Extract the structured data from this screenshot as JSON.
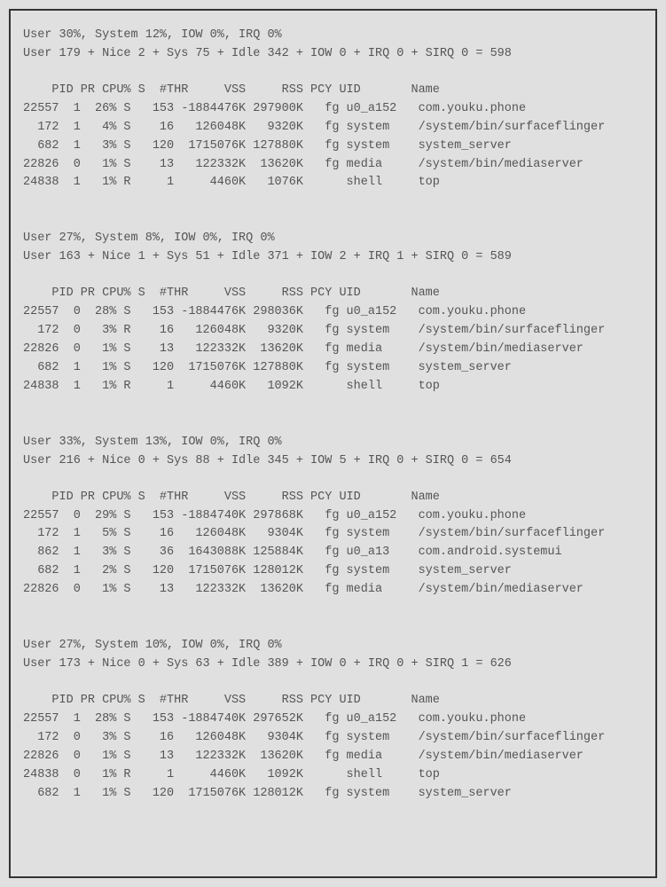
{
  "columns": [
    "PID",
    "PR",
    "CPU%",
    "S",
    "#THR",
    "VSS",
    "RSS",
    "PCY",
    "UID",
    "Name"
  ],
  "blocks": [
    {
      "summary1": "User 30%, System 12%, IOW 0%, IRQ 0%",
      "summary2": "User 179 + Nice 2 + Sys 75 + Idle 342 + IOW 0 + IRQ 0 + SIRQ 0 = 598",
      "rows": [
        {
          "pid": "22557",
          "pr": "1",
          "cpu": "26%",
          "s": "S",
          "thr": "153",
          "vss": "-1884476K",
          "rss": "297900K",
          "pcy": "fg",
          "uid": "u0_a152",
          "name": "com.youku.phone"
        },
        {
          "pid": "172",
          "pr": "1",
          "cpu": "4%",
          "s": "S",
          "thr": "16",
          "vss": "126048K",
          "rss": "9320K",
          "pcy": "fg",
          "uid": "system",
          "name": "/system/bin/surfaceflinger"
        },
        {
          "pid": "682",
          "pr": "1",
          "cpu": "3%",
          "s": "S",
          "thr": "120",
          "vss": "1715076K",
          "rss": "127880K",
          "pcy": "fg",
          "uid": "system",
          "name": "system_server"
        },
        {
          "pid": "22826",
          "pr": "0",
          "cpu": "1%",
          "s": "S",
          "thr": "13",
          "vss": "122332K",
          "rss": "13620K",
          "pcy": "fg",
          "uid": "media",
          "name": "/system/bin/mediaserver"
        },
        {
          "pid": "24838",
          "pr": "1",
          "cpu": "1%",
          "s": "R",
          "thr": "1",
          "vss": "4460K",
          "rss": "1076K",
          "pcy": "",
          "uid": "shell",
          "name": "top"
        }
      ]
    },
    {
      "summary1": "User 27%, System 8%, IOW 0%, IRQ 0%",
      "summary2": "User 163 + Nice 1 + Sys 51 + Idle 371 + IOW 2 + IRQ 1 + SIRQ 0 = 589",
      "rows": [
        {
          "pid": "22557",
          "pr": "0",
          "cpu": "28%",
          "s": "S",
          "thr": "153",
          "vss": "-1884476K",
          "rss": "298036K",
          "pcy": "fg",
          "uid": "u0_a152",
          "name": "com.youku.phone"
        },
        {
          "pid": "172",
          "pr": "0",
          "cpu": "3%",
          "s": "R",
          "thr": "16",
          "vss": "126048K",
          "rss": "9320K",
          "pcy": "fg",
          "uid": "system",
          "name": "/system/bin/surfaceflinger"
        },
        {
          "pid": "22826",
          "pr": "0",
          "cpu": "1%",
          "s": "S",
          "thr": "13",
          "vss": "122332K",
          "rss": "13620K",
          "pcy": "fg",
          "uid": "media",
          "name": "/system/bin/mediaserver"
        },
        {
          "pid": "682",
          "pr": "1",
          "cpu": "1%",
          "s": "S",
          "thr": "120",
          "vss": "1715076K",
          "rss": "127880K",
          "pcy": "fg",
          "uid": "system",
          "name": "system_server"
        },
        {
          "pid": "24838",
          "pr": "1",
          "cpu": "1%",
          "s": "R",
          "thr": "1",
          "vss": "4460K",
          "rss": "1092K",
          "pcy": "",
          "uid": "shell",
          "name": "top"
        }
      ]
    },
    {
      "summary1": "User 33%, System 13%, IOW 0%, IRQ 0%",
      "summary2": "User 216 + Nice 0 + Sys 88 + Idle 345 + IOW 5 + IRQ 0 + SIRQ 0 = 654",
      "rows": [
        {
          "pid": "22557",
          "pr": "0",
          "cpu": "29%",
          "s": "S",
          "thr": "153",
          "vss": "-1884740K",
          "rss": "297868K",
          "pcy": "fg",
          "uid": "u0_a152",
          "name": "com.youku.phone"
        },
        {
          "pid": "172",
          "pr": "1",
          "cpu": "5%",
          "s": "S",
          "thr": "16",
          "vss": "126048K",
          "rss": "9304K",
          "pcy": "fg",
          "uid": "system",
          "name": "/system/bin/surfaceflinger"
        },
        {
          "pid": "862",
          "pr": "1",
          "cpu": "3%",
          "s": "S",
          "thr": "36",
          "vss": "1643088K",
          "rss": "125884K",
          "pcy": "fg",
          "uid": "u0_a13",
          "name": "com.android.systemui"
        },
        {
          "pid": "682",
          "pr": "1",
          "cpu": "2%",
          "s": "S",
          "thr": "120",
          "vss": "1715076K",
          "rss": "128012K",
          "pcy": "fg",
          "uid": "system",
          "name": "system_server"
        },
        {
          "pid": "22826",
          "pr": "0",
          "cpu": "1%",
          "s": "S",
          "thr": "13",
          "vss": "122332K",
          "rss": "13620K",
          "pcy": "fg",
          "uid": "media",
          "name": "/system/bin/mediaserver"
        }
      ]
    },
    {
      "summary1": "User 27%, System 10%, IOW 0%, IRQ 0%",
      "summary2": "User 173 + Nice 0 + Sys 63 + Idle 389 + IOW 0 + IRQ 0 + SIRQ 1 = 626",
      "rows": [
        {
          "pid": "22557",
          "pr": "1",
          "cpu": "28%",
          "s": "S",
          "thr": "153",
          "vss": "-1884740K",
          "rss": "297652K",
          "pcy": "fg",
          "uid": "u0_a152",
          "name": "com.youku.phone"
        },
        {
          "pid": "172",
          "pr": "0",
          "cpu": "3%",
          "s": "S",
          "thr": "16",
          "vss": "126048K",
          "rss": "9304K",
          "pcy": "fg",
          "uid": "system",
          "name": "/system/bin/surfaceflinger"
        },
        {
          "pid": "22826",
          "pr": "0",
          "cpu": "1%",
          "s": "S",
          "thr": "13",
          "vss": "122332K",
          "rss": "13620K",
          "pcy": "fg",
          "uid": "media",
          "name": "/system/bin/mediaserver"
        },
        {
          "pid": "24838",
          "pr": "0",
          "cpu": "1%",
          "s": "R",
          "thr": "1",
          "vss": "4460K",
          "rss": "1092K",
          "pcy": "",
          "uid": "shell",
          "name": "top"
        },
        {
          "pid": "682",
          "pr": "1",
          "cpu": "1%",
          "s": "S",
          "thr": "120",
          "vss": "1715076K",
          "rss": "128012K",
          "pcy": "fg",
          "uid": "system",
          "name": "system_server"
        }
      ]
    }
  ]
}
